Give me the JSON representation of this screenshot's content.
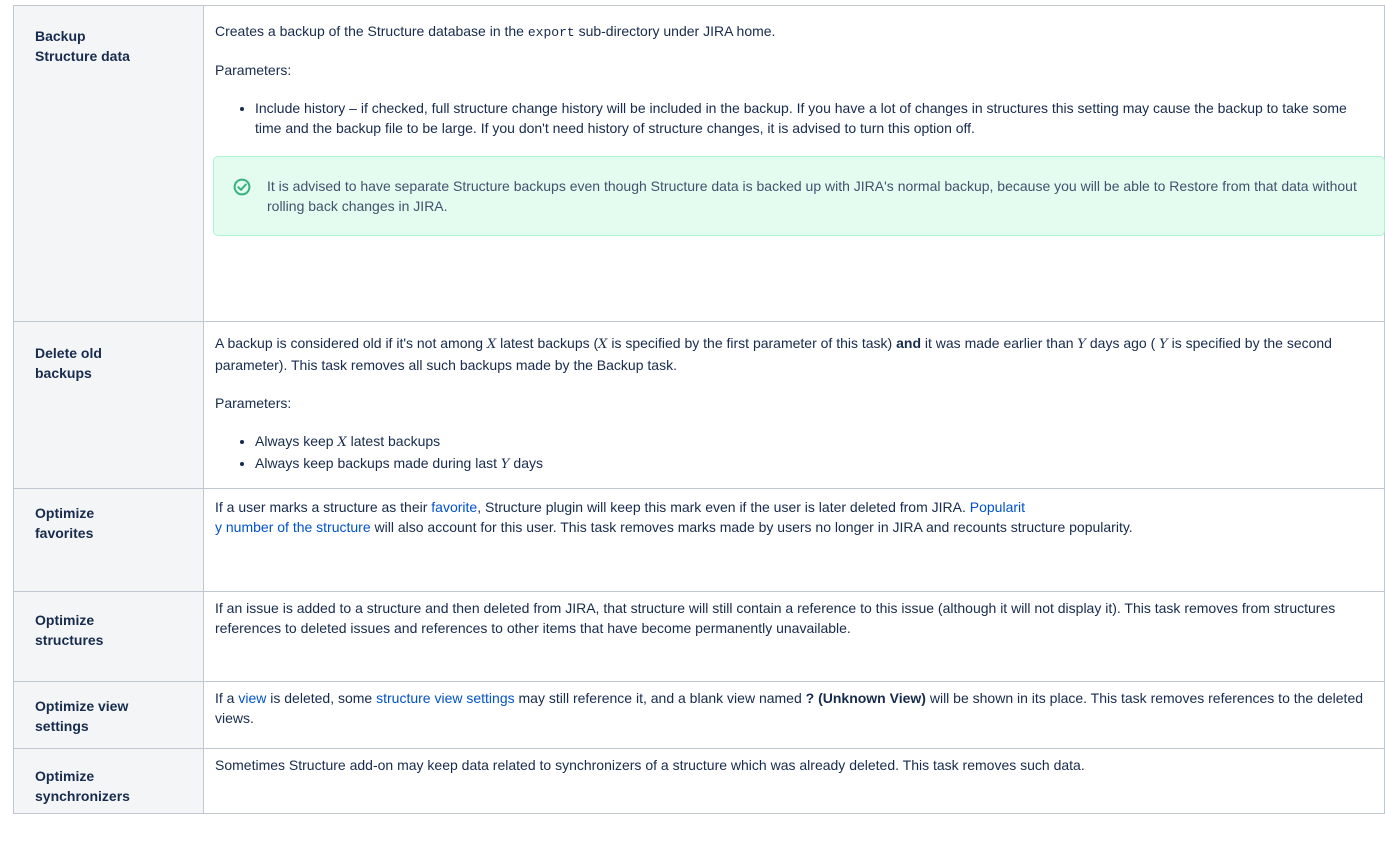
{
  "tasks": [
    {
      "name_l1": "Backup",
      "name_l2": "Structure data",
      "desc_pre": "Creates a backup of the Structure database in the ",
      "desc_code": "export",
      "desc_post": " sub-directory under JIRA home.",
      "params_label": "Parameters:",
      "bullet": "Include history – if checked, full structure change history will be included in the backup. If you have a lot of changes in structures this setting may cause the backup to take some time and the backup file to be large. If you don't need history of structure changes, it is advised to turn this option off.",
      "tip_icon": "check-circle-icon",
      "tip_text": "It is advised to have separate Structure backups even though Structure data is backed up with JIRA's normal backup, because you will be able to Restore from that data without rolling back changes in JIRA."
    },
    {
      "name_l1": "Delete old",
      "name_l2": "backups",
      "p1": "A backup is considered old if it's not among ",
      "x": "X",
      "p2": "latest backups (",
      "p3": "is specified by the first parameter of this task) ",
      "and": "and",
      "p4": " it was made earlier than ",
      "y": "Y",
      "p5": "days ago ( ",
      "p6": "is specified by the second parameter). This task removes all such backups made by the Backup task.",
      "params_label": "Parameters:",
      "b1_pre": "Always keep ",
      "b1_post": "latest backups",
      "b2_pre": "Always keep backups made during last ",
      "b2_post": "days"
    },
    {
      "name_l1": "Optimize",
      "name_l2": "favorites",
      "p1": "If a user marks a structure as their ",
      "link1": "favorite",
      "p2": ", Structure plugin will keep this mark even if the user is later deleted from JIRA. ",
      "link2a": "Popularit",
      "link2b": "y number of the structure",
      "p3": " will also account for this user. This task removes marks made by users no longer in JIRA and recounts structure popularity."
    },
    {
      "name_l1": "Optimize",
      "name_l2": "structures",
      "text": "If an issue is added to a structure and then deleted from JIRA, that structure will still contain a reference to this issue (although it will not display it). This task removes from structures references to deleted issues and references to other items that have become permanently unavailable."
    },
    {
      "name_l1": "Optimize view",
      "name_l2": "settings",
      "p1": "If a ",
      "link1": "view",
      "p2": " is deleted, some ",
      "link2": "structure view settings",
      "p3": " may still reference it, and a blank view named ",
      "bold": "? (Unknown View)",
      "p4": " will be shown in its place. This task removes references to the deleted views."
    },
    {
      "name_l1": "Optimize",
      "name_l2": "synchronizers",
      "text": "Sometimes Structure add-on may keep data related to synchronizers of a structure which was already deleted. This task removes such data."
    }
  ]
}
